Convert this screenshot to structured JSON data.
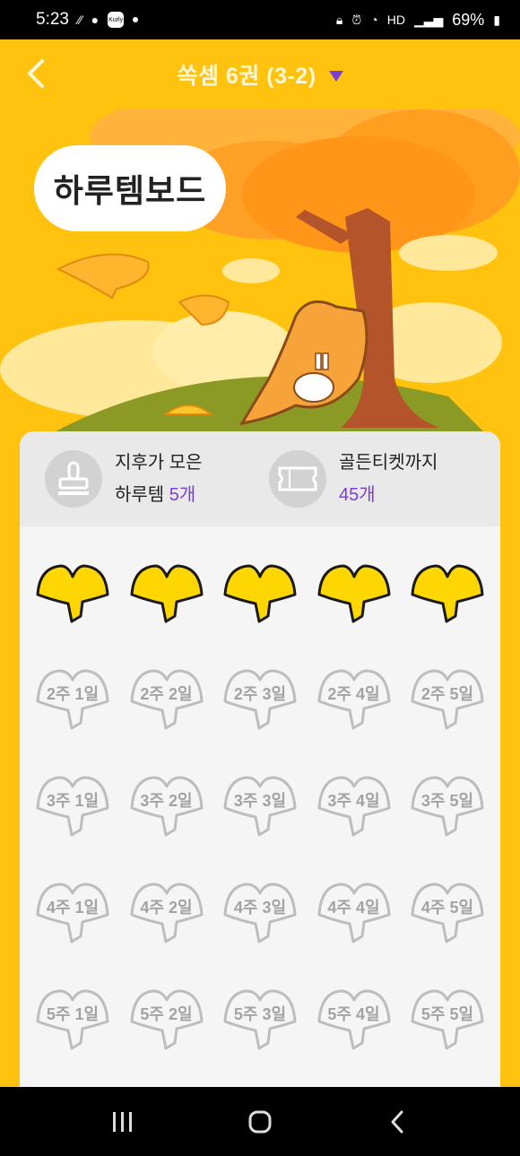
{
  "status_bar": {
    "time": "5:23",
    "battery": "69%",
    "app_icon_label": "Kurly"
  },
  "header": {
    "title": "쏙셈 6권 (3-2)",
    "accent_color": "#7A3FD6"
  },
  "hero": {
    "bubble_text": "하루템보드"
  },
  "stats": {
    "collected_line1": "지후가 모은",
    "collected_line2_prefix": "하루템",
    "collected_count": "5개",
    "golden_label": "골든티켓까지",
    "golden_count": "45개"
  },
  "board": {
    "collected_row": [
      "",
      "",
      "",
      "",
      ""
    ],
    "rows": [
      [
        "2주 1일",
        "2주 2일",
        "2주 3일",
        "2주 4일",
        "2주 5일"
      ],
      [
        "3주 1일",
        "3주 2일",
        "3주 3일",
        "3주 4일",
        "3주 5일"
      ],
      [
        "4주 1일",
        "4주 2일",
        "4주 3일",
        "4주 4일",
        "4주 5일"
      ],
      [
        "5주 1일",
        "5주 2일",
        "5주 3일",
        "5주 4일",
        "5주 5일"
      ]
    ]
  },
  "icons": {
    "back": "back-arrow-icon",
    "dropdown": "triangle-down-icon",
    "stamp": "stamp-icon",
    "ticket": "ticket-icon",
    "leaf_collected": "ginkgo-leaf-gold-icon",
    "leaf_empty": "ginkgo-leaf-outline-icon"
  }
}
